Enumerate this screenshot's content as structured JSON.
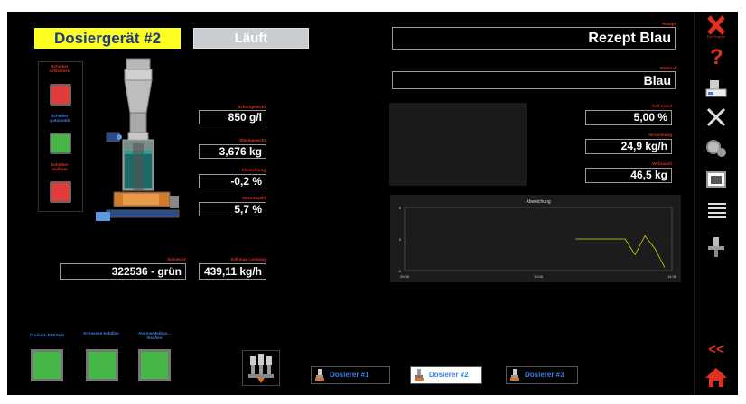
{
  "header": {
    "device_title": "Dosiergerät #2",
    "status": "Läuft"
  },
  "recipe": {
    "label": "Rezept",
    "value": "Rezept Blau"
  },
  "material": {
    "label": "Material",
    "value": "Blau"
  },
  "slider_group": {
    "close_label": "Schieber\nschliessen",
    "auto_label": "Schieber\nAutomatik",
    "open_label": "Schieber\nmaßfest"
  },
  "values": {
    "schuettgewicht": {
      "label": "Schüttgewicht",
      "value": "850 g/l"
    },
    "stickgewicht": {
      "label": "Stückgewicht",
      "value": "3,676 kg"
    },
    "abweichung": {
      "label": "Abweichung",
      "value": "-0,2 %"
    },
    "ist_drehzahl": {
      "label": "Ist-Drehzahl",
      "value": "5,7 %"
    },
    "schnecke": {
      "label": "Schnecke",
      "value": "322536 - grün"
    },
    "soll_max_leistung": {
      "label": "Soll max. Leistung",
      "value": "439,11 kg/h"
    },
    "soll_anteil": {
      "label": "Soll-Anteil",
      "value": "5,00 %"
    },
    "ist_leistung": {
      "label": "Ist-Leistung",
      "value": "24,9 kg/h"
    },
    "verbrauch": {
      "label": "Verbrauch",
      "value": "46,5 kg"
    }
  },
  "bottom_buttons": [
    {
      "label": "Produkt. EIN/AUS"
    },
    {
      "label": "Schnecke befüllen"
    },
    {
      "label": "Alarme/Meldun... löschen"
    }
  ],
  "tabs": [
    {
      "label": "Dosierer #1",
      "active": false
    },
    {
      "label": "Dosierer #2",
      "active": true
    },
    {
      "label": "Dosierer #3",
      "active": false
    }
  ],
  "chart_data": {
    "type": "line",
    "title": "Abweichung",
    "y_ticks": [
      "5",
      "0",
      "-5"
    ],
    "x_ticks": [
      "09:39",
      "10:06",
      "14:36"
    ],
    "series": [
      {
        "values": [
          0,
          0,
          0,
          0,
          0,
          0,
          -2.5,
          0.5,
          -1.5,
          -4.5
        ]
      }
    ],
    "ylim": [
      -5,
      5
    ],
    "color": "#d8d800"
  },
  "sidebar": {
    "close_label": "End Program",
    "items": [
      "close-icon",
      "help-icon",
      "scale-icon",
      "tools-icon",
      "gears-icon",
      "camera-icon",
      "list-icon",
      "dosing-icon"
    ],
    "back_label": "<<"
  },
  "colors": {
    "accent_yellow": "#ffff22",
    "alert_red": "#e0301e",
    "info_blue": "#3a7fe0",
    "ok_green": "#48b548"
  }
}
